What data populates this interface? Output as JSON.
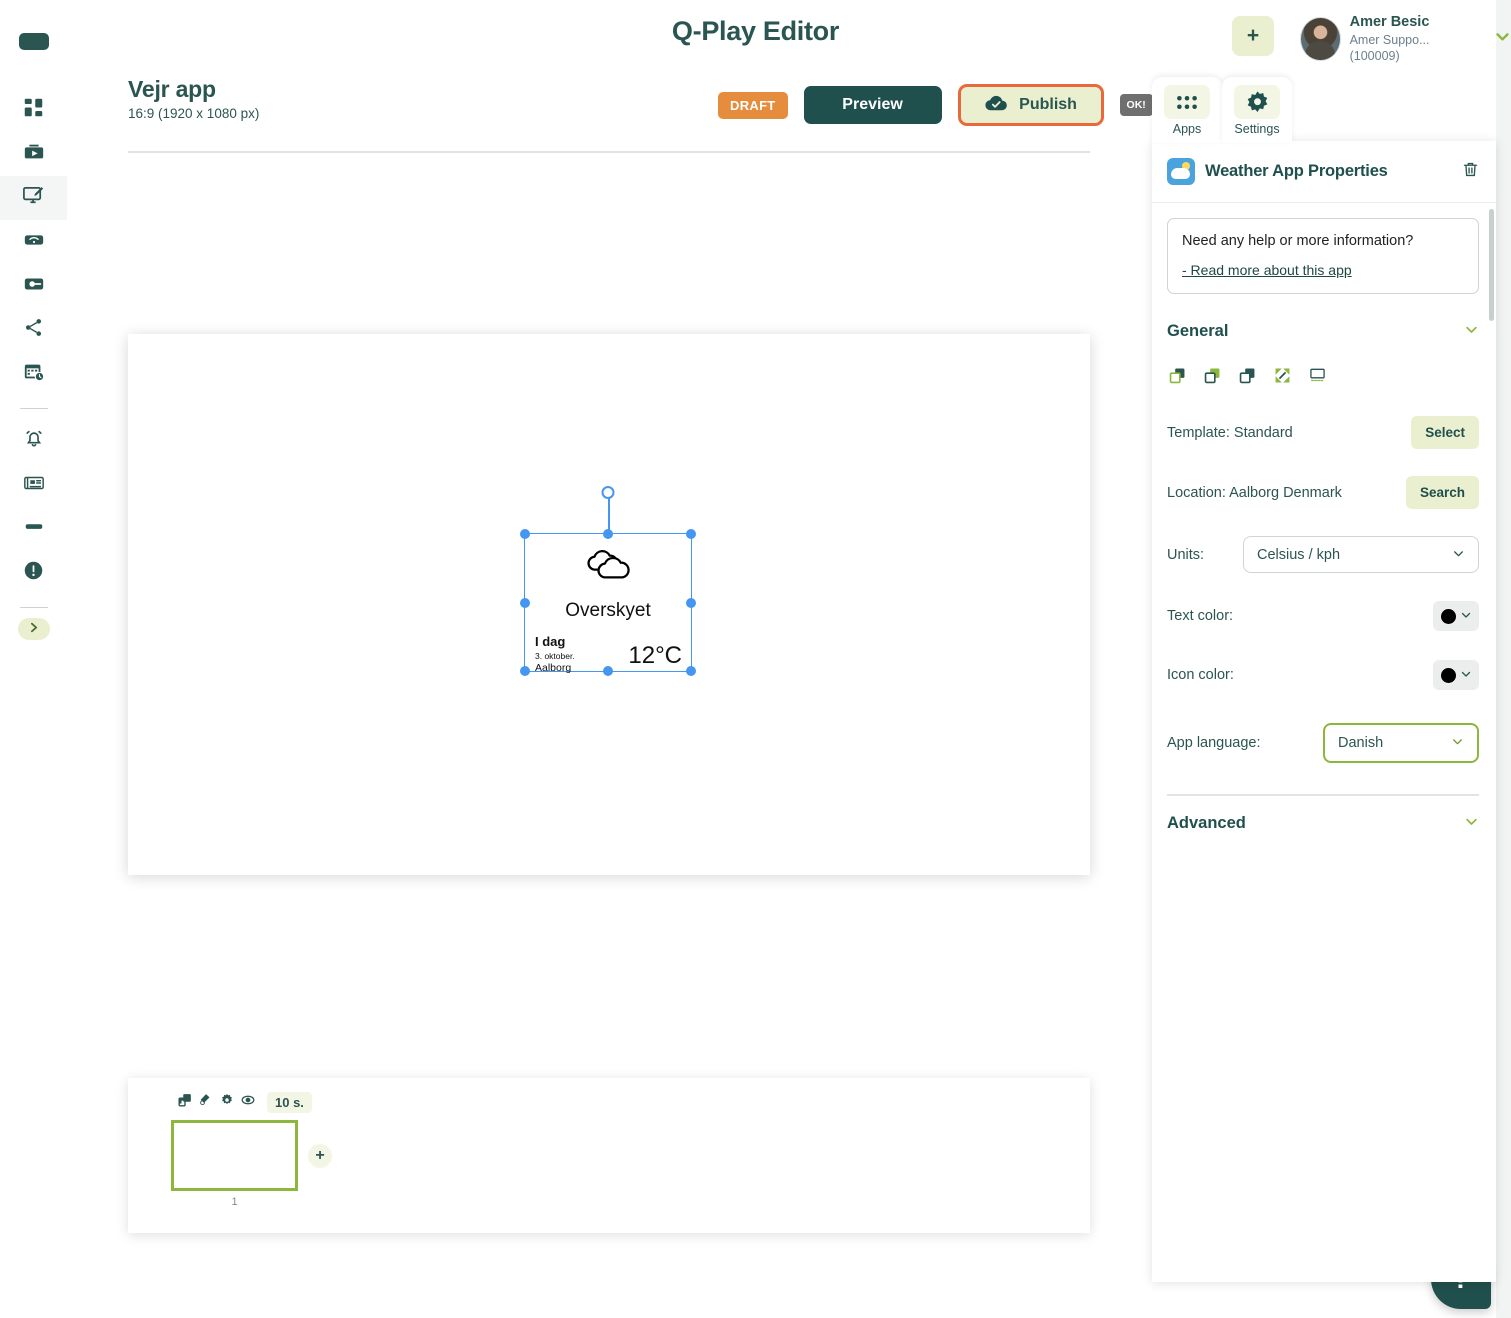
{
  "app": {
    "title": "Q-Play Editor",
    "add_button": "+",
    "user": {
      "name": "Amer Besic",
      "org": "Amer Suppo...(100009)",
      "caret": "chevron-down"
    }
  },
  "rail": {
    "logo": "qplay-logo",
    "items": [
      {
        "name": "dashboard",
        "icon": "dashboard-icon",
        "active": false
      },
      {
        "name": "media",
        "icon": "media-play-icon",
        "active": false
      },
      {
        "name": "editor",
        "icon": "screen-edit-icon",
        "active": true
      },
      {
        "name": "network",
        "icon": "wifi-screen-icon",
        "active": false
      },
      {
        "name": "players",
        "icon": "player-device-icon",
        "active": false
      },
      {
        "name": "share",
        "icon": "share-nodes-icon",
        "active": false
      },
      {
        "name": "schedule",
        "icon": "calendar-clock-icon",
        "active": false
      },
      {
        "name": "alerts",
        "icon": "bell-icon",
        "active": false
      },
      {
        "name": "news",
        "icon": "newspaper-icon",
        "active": false
      },
      {
        "name": "display",
        "icon": "bar-icon",
        "active": false
      },
      {
        "name": "info",
        "icon": "exclamation-circle-icon",
        "active": false
      }
    ],
    "expand": "chevron-right"
  },
  "document": {
    "name": "Vejr app",
    "format": "16:9 (1920 x 1080 px)",
    "status_badge": "DRAFT",
    "preview_label": "Preview",
    "publish_label": "Publish",
    "publish_icon": "cloud-check-icon",
    "ok_badge": "OK!"
  },
  "canvas": {
    "widget": {
      "icon": "cloudy-icon",
      "condition": "Overskyet",
      "today_label": "I dag",
      "date": "3. oktober.",
      "city": "Aalborg",
      "temperature": "12°C"
    }
  },
  "slides": {
    "tools": [
      "duplicate-icon",
      "paint-icon",
      "gear-icon",
      "eye-icon"
    ],
    "duration": "10 s.",
    "slide_number": "1",
    "add_label": "+"
  },
  "right_panel": {
    "tabs": [
      {
        "label": "Apps",
        "icon": "grid-apps-icon",
        "active": false
      },
      {
        "label": "Settings",
        "icon": "gear-icon",
        "active": true
      }
    ],
    "header": {
      "title": "Weather App Properties",
      "icon": "weather-app-icon",
      "delete_icon": "trash-icon"
    },
    "help": {
      "question": "Need any help or more information?",
      "link": "- Read more about this app"
    },
    "general": {
      "title": "General",
      "caret": "chevron-down",
      "icons": [
        "bring-forward-icon",
        "send-backward-icon",
        "duplicate-icon",
        "fit-expand-icon",
        "align-bottom-icon"
      ],
      "template_label": "Template: Standard",
      "template_button": "Select",
      "location_label": "Location: Aalborg Denmark",
      "location_button": "Search",
      "units_label": "Units:",
      "units_value": "Celsius / kph",
      "text_color_label": "Text color:",
      "text_color_value": "#000000",
      "icon_color_label": "Icon color:",
      "icon_color_value": "#000000",
      "language_label": "App language:",
      "language_value": "Danish"
    },
    "advanced": {
      "title": "Advanced",
      "caret": "chevron-down"
    }
  },
  "help_fab": {
    "label": "?"
  },
  "colors": {
    "brand_dark": "#20504d",
    "brand_text": "#2b5551",
    "accent_green": "#8cb63c",
    "pale_green": "#e9efcf",
    "orange": "#e58c3d",
    "highlight_orange": "#e8693c",
    "selection_blue": "#4596f0"
  }
}
